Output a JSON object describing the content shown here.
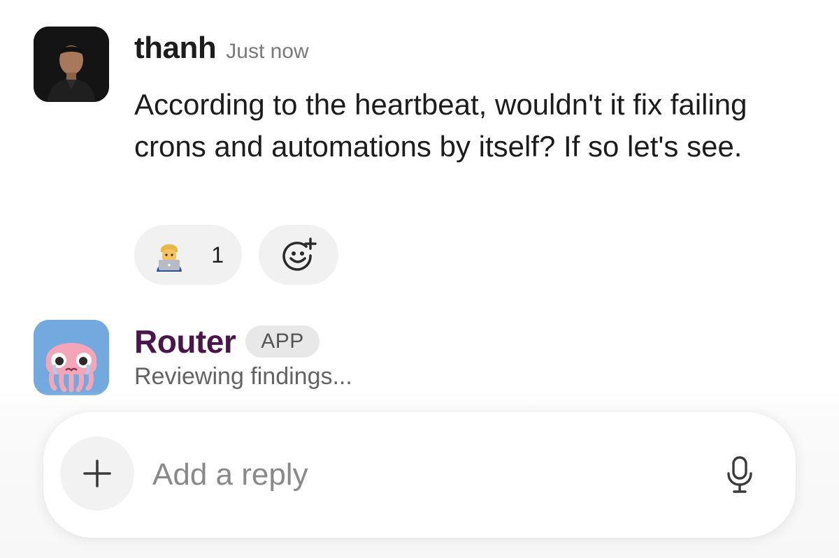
{
  "message_1": {
    "username": "thanh",
    "timestamp": "Just now",
    "text": "According to the heartbeat, wouldn't it fix failing crons and automations by itself? If so let's see.",
    "reaction": {
      "emoji": "technologist-emoji",
      "count": "1"
    },
    "add_reaction_icon": "add-reaction-icon"
  },
  "message_2": {
    "username": "Router",
    "badge": "APP",
    "status": "Reviewing findings..."
  },
  "composer": {
    "placeholder": "Add a reply",
    "plus_icon": "plus-icon",
    "mic_icon": "microphone-icon"
  },
  "colors": {
    "router_name": "#4a154b",
    "pill_bg": "#f1f1f1",
    "text": "#1d1c1d",
    "muted": "#7a797a"
  }
}
